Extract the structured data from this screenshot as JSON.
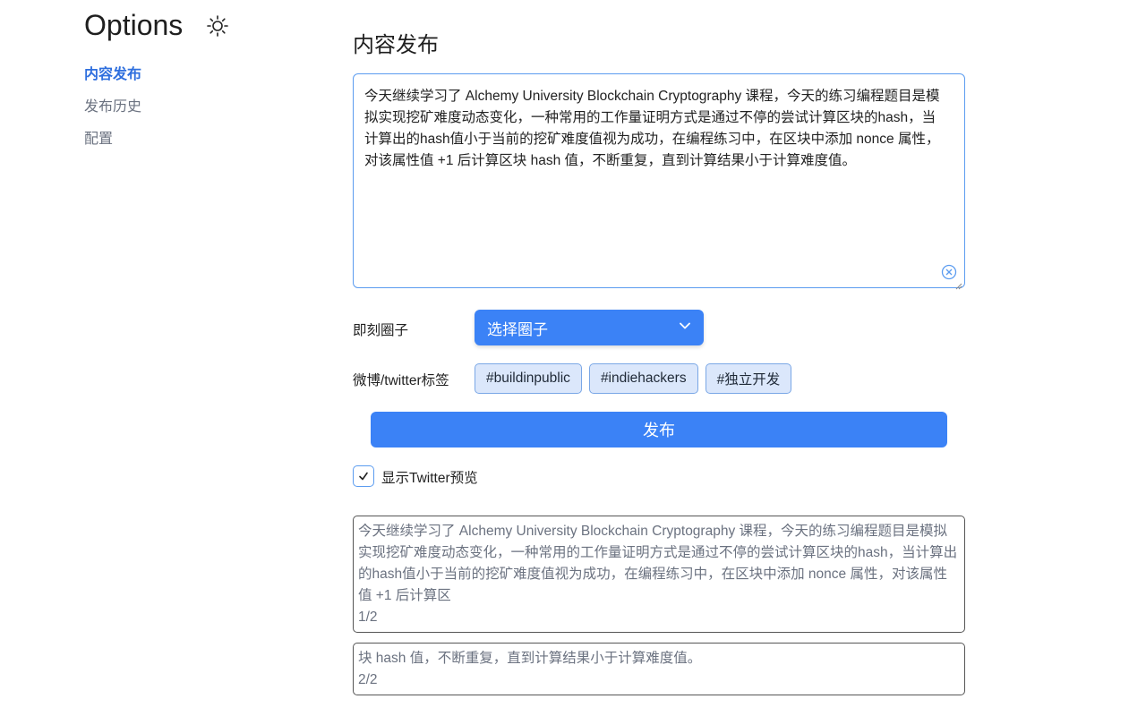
{
  "sidebar": {
    "title": "Options",
    "items": [
      {
        "label": "内容发布",
        "active": true
      },
      {
        "label": "发布历史",
        "active": false
      },
      {
        "label": "配置",
        "active": false
      }
    ],
    "theme_icon": "sun-icon"
  },
  "main": {
    "heading": "内容发布",
    "editor": {
      "value": "今天继续学习了 Alchemy University Blockchain Cryptography 课程，今天的练习编程题目是模拟实现挖矿难度动态变化，一种常用的工作量证明方式是通过不停的尝试计算区块的hash，当计算出的hash值小于当前的挖矿难度值视为成功，在编程练习中，在区块中添加 nonce 属性，对该属性值 +1 后计算区块 hash 值，不断重复，直到计算结果小于计算难度值。",
      "clear_icon": "clear-circle-icon"
    },
    "circle": {
      "label": "即刻圈子",
      "selected": "选择圈子"
    },
    "tags": {
      "label": "微博/twitter标签",
      "items": [
        "#buildinpublic",
        "#indiehackers",
        "#独立开发"
      ]
    },
    "publish_label": "发布",
    "preview": {
      "label": "显示Twitter预览",
      "checked": true
    },
    "tweets": [
      {
        "text": "今天继续学习了 Alchemy University Blockchain Cryptography 课程，今天的练习编程题目是模拟实现挖矿难度动态变化，一种常用的工作量证明方式是通过不停的尝试计算区块的hash，当计算出的hash值小于当前的挖矿难度值视为成功，在编程练习中，在区块中添加 nonce 属性，对该属性值 +1 后计算区",
        "count": "1/2"
      },
      {
        "text": "块 hash 值，不断重复，直到计算结果小于计算难度值。",
        "count": "2/2"
      }
    ]
  },
  "colors": {
    "accent": "#3b82f6",
    "active_nav": "#2f6fde",
    "tag_bg": "#dbe7fb"
  }
}
